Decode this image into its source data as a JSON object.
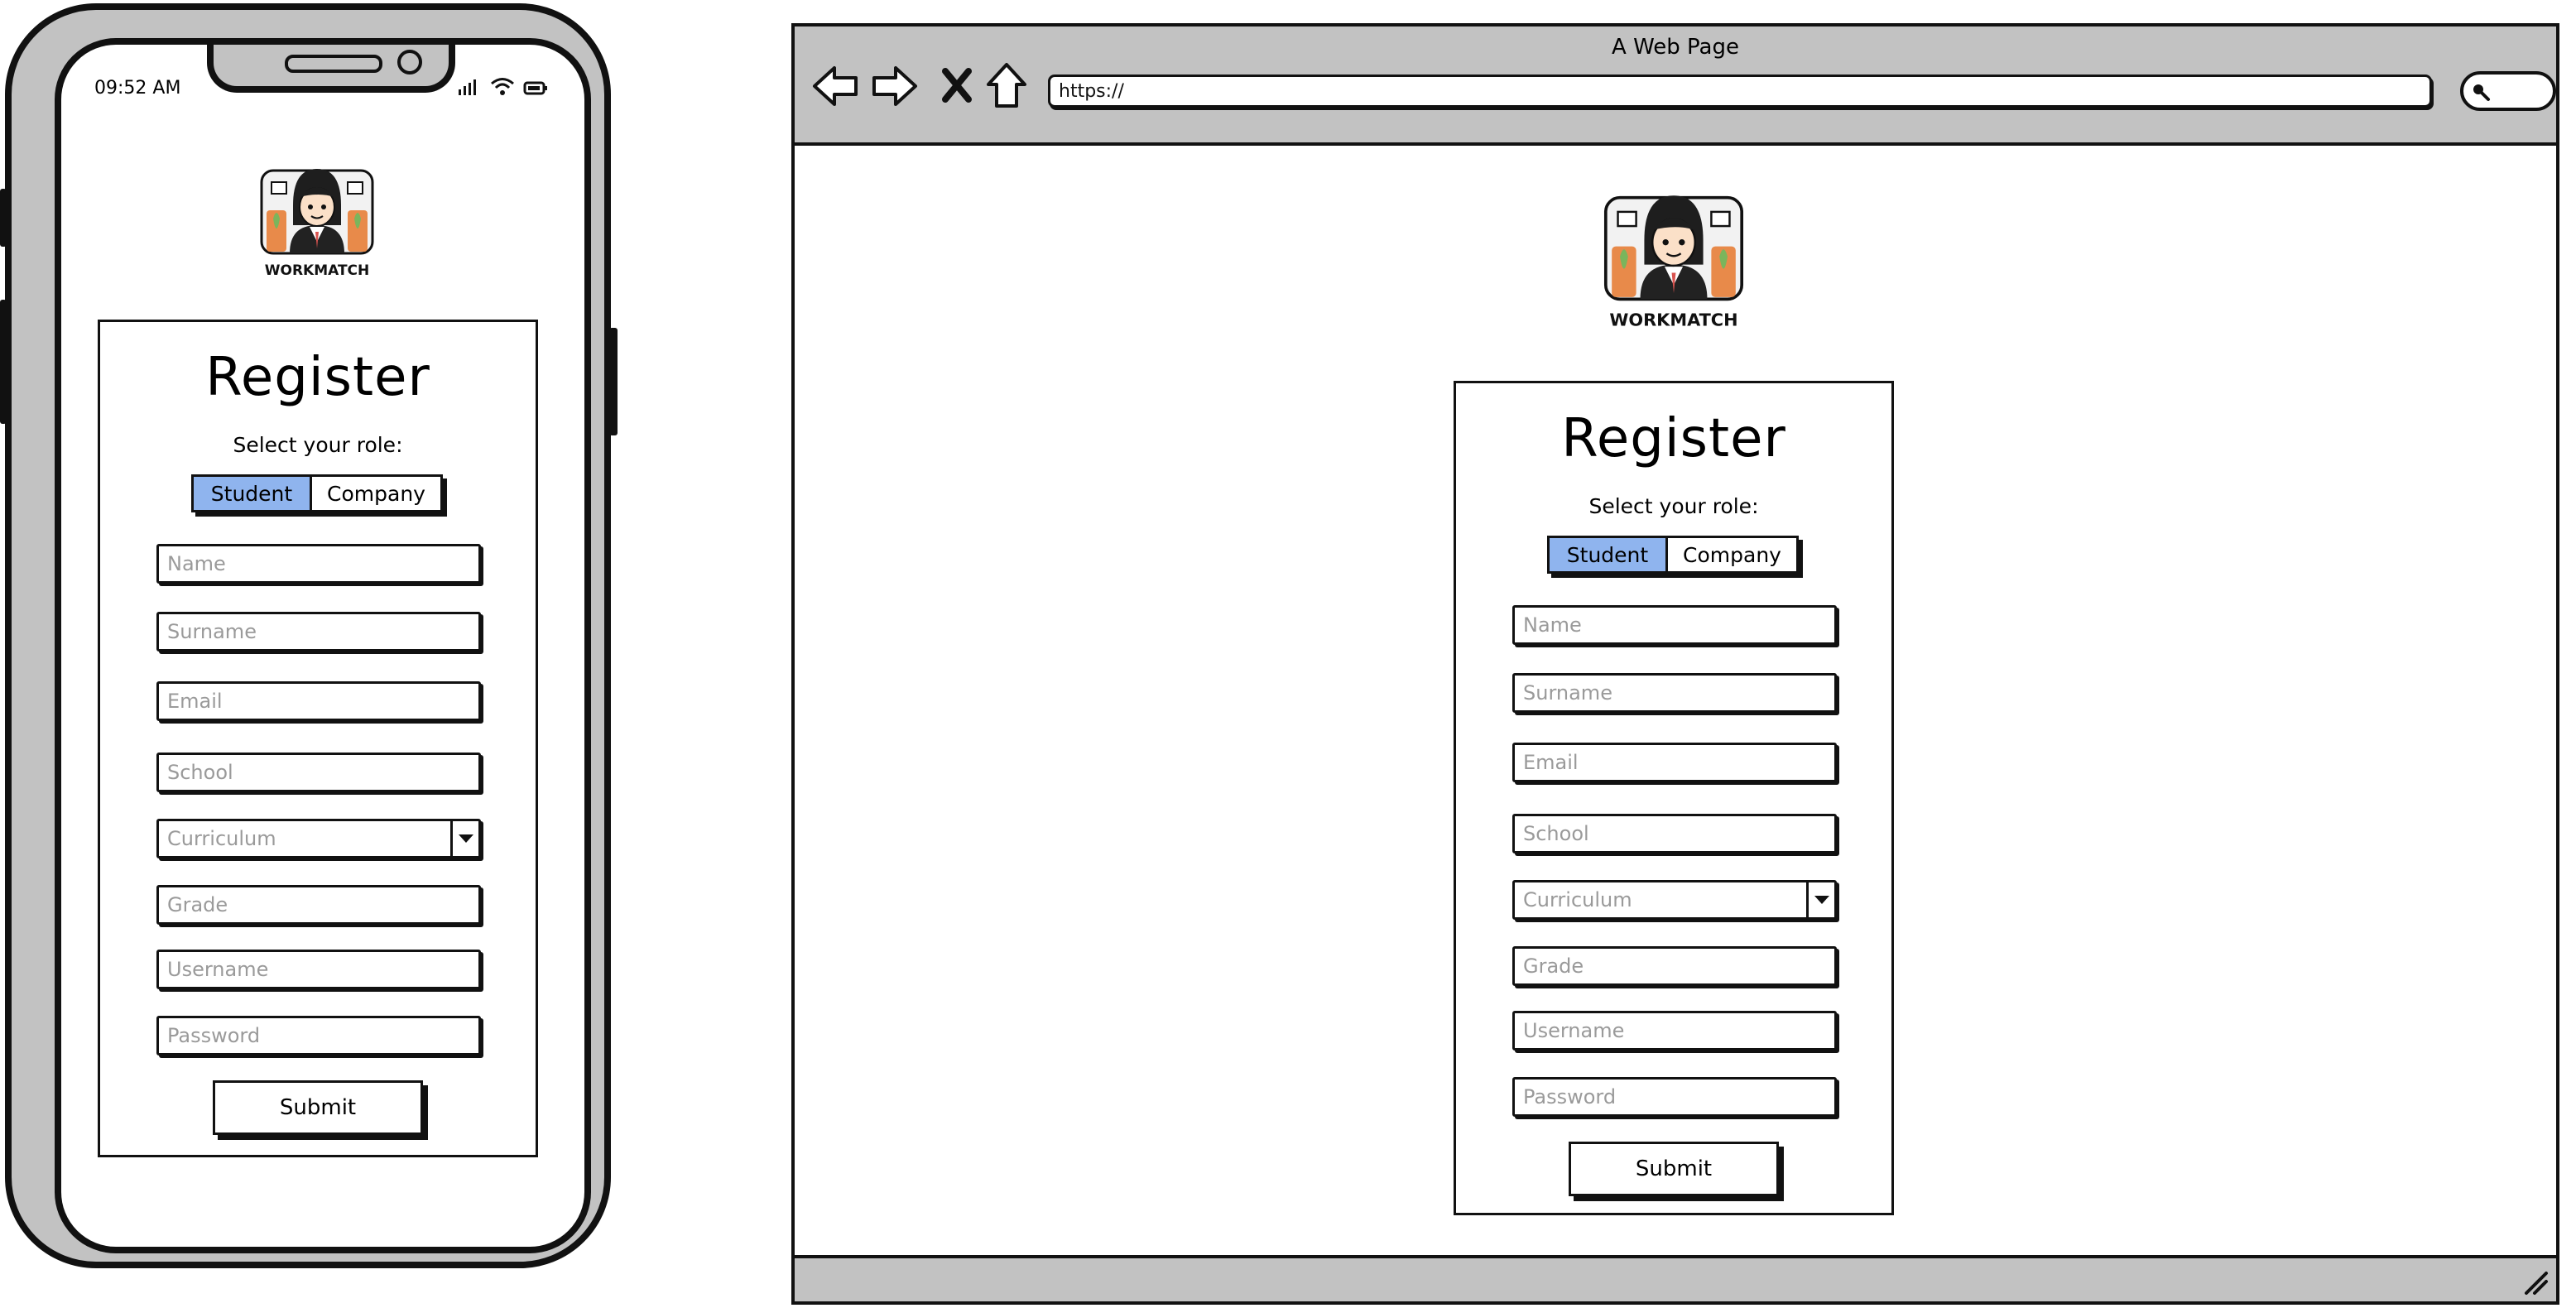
{
  "phone": {
    "status_time": "09:52 AM"
  },
  "browser": {
    "title": "A Web Page",
    "url": "https://"
  },
  "logo": {
    "text": "WORKMATCH"
  },
  "form": {
    "title": "Register",
    "role_label": "Select your role:",
    "roles": [
      {
        "label": "Student",
        "selected": true
      },
      {
        "label": "Company",
        "selected": false
      }
    ],
    "fields": {
      "name": "Name",
      "surname": "Surname",
      "email": "Email",
      "school": "School",
      "curriculum": "Curriculum",
      "grade": "Grade",
      "username": "Username",
      "password": "Password"
    },
    "submit_label": "Submit"
  },
  "colors": {
    "frame_gray": "#c2c2c2",
    "selected_role": "#8fb4ee",
    "outline": "#111111"
  }
}
